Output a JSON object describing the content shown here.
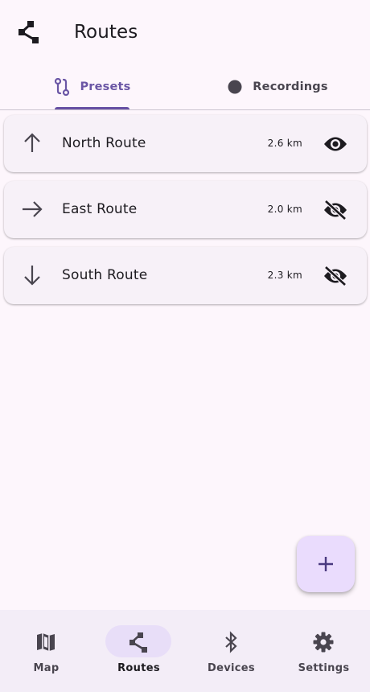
{
  "header": {
    "title": "Routes",
    "icon": "route-share-icon"
  },
  "tabs": [
    {
      "label": "Presets",
      "icon": "route-icon",
      "selected": true
    },
    {
      "label": "Recordings",
      "icon": "record-dot-icon",
      "selected": false
    }
  ],
  "routes": [
    {
      "name": "North Route",
      "distance": "2.6 km",
      "direction_icon": "arrow-up-icon",
      "visible": true
    },
    {
      "name": "East Route",
      "distance": "2.0 km",
      "direction_icon": "arrow-right-icon",
      "visible": false
    },
    {
      "name": "South Route",
      "distance": "2.3 km",
      "direction_icon": "arrow-down-icon",
      "visible": false
    }
  ],
  "fab": {
    "icon": "plus-icon"
  },
  "bottom_nav": [
    {
      "label": "Map",
      "icon": "map-icon",
      "active": false
    },
    {
      "label": "Routes",
      "icon": "route-share-icon",
      "active": true
    },
    {
      "label": "Devices",
      "icon": "bluetooth-icon",
      "active": false
    },
    {
      "label": "Settings",
      "icon": "gear-icon",
      "active": false
    }
  ],
  "colors": {
    "background": "#fdf6fc",
    "primary": "#6750a4",
    "card": "#f7f1f8",
    "fab": "#eadcfd",
    "nav_bar": "#f3edf7",
    "nav_active_pill": "#e8def8",
    "icon_dark": "#1d1b20"
  }
}
